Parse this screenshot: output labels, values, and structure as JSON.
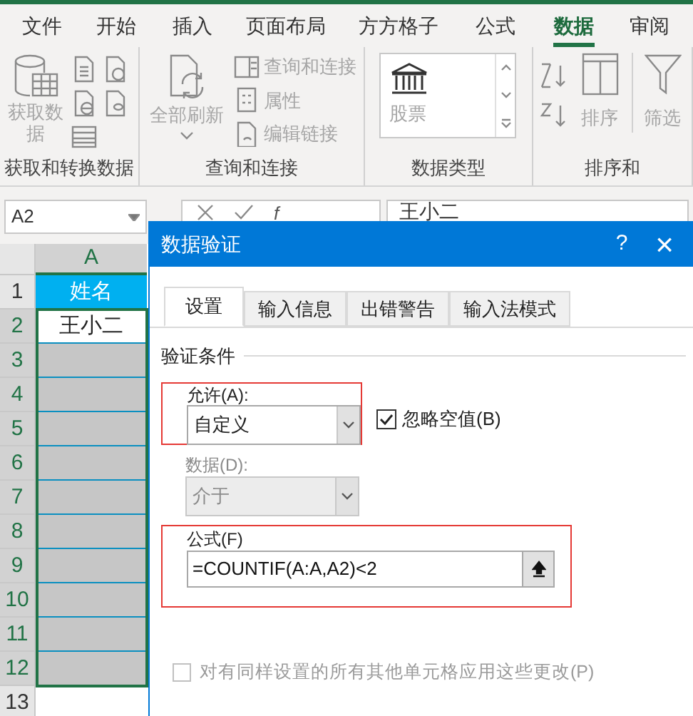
{
  "ribbon_tabs": [
    {
      "label": "文件",
      "selected": false
    },
    {
      "label": "开始",
      "selected": false
    },
    {
      "label": "插入",
      "selected": false
    },
    {
      "label": "页面布局",
      "selected": false
    },
    {
      "label": "方方格子",
      "selected": false
    },
    {
      "label": "公式",
      "selected": false
    },
    {
      "label": "数据",
      "selected": true
    },
    {
      "label": "审阅",
      "selected": false
    }
  ],
  "ribbon_groups": [
    {
      "label": "获取和转换数据",
      "buttons": [
        "获取数据"
      ]
    },
    {
      "label": "查询和连接",
      "buttons": [
        "全部刷新",
        "查询和连接",
        "属性",
        "编辑链接"
      ]
    },
    {
      "label": "数据类型",
      "buttons": [
        "股票"
      ]
    },
    {
      "label": "排序和",
      "buttons": [
        "排序",
        "筛选"
      ]
    }
  ],
  "name_box": "A2",
  "function_label": "f",
  "formula": "王小二",
  "sheet": {
    "column": "A",
    "rows": [
      {
        "number": "1",
        "value": "姓名",
        "kind": "header",
        "selected": false
      },
      {
        "number": "2",
        "value": "王小二",
        "kind": "data",
        "selected": true
      },
      {
        "number": "3",
        "kind": "data",
        "selected": true
      },
      {
        "number": "4",
        "kind": "data",
        "selected": true
      },
      {
        "number": "5",
        "kind": "data",
        "selected": true
      },
      {
        "number": "6",
        "kind": "data",
        "selected": true
      },
      {
        "number": "7",
        "kind": "data",
        "selected": true
      },
      {
        "number": "8",
        "kind": "data",
        "selected": true
      },
      {
        "number": "9",
        "kind": "data",
        "selected": true
      },
      {
        "number": "10",
        "kind": "data",
        "selected": true
      },
      {
        "number": "11",
        "kind": "data",
        "selected": true
      },
      {
        "number": "12",
        "kind": "data",
        "selected": true
      },
      {
        "number": "13",
        "kind": "data",
        "selected": false
      }
    ]
  },
  "dialog": {
    "title": "数据验证",
    "help": "?",
    "close": "×",
    "tabs": [
      {
        "label": "设置",
        "selected": true
      },
      {
        "label": "输入信息",
        "selected": false
      },
      {
        "label": "出错警告",
        "selected": false
      },
      {
        "label": "输入法模式",
        "selected": false
      }
    ],
    "section": "验证条件",
    "allow": {
      "label": "允许(A):",
      "value": "自定义",
      "disabled": false
    },
    "ignore_blank": {
      "label": "忽略空值(B)",
      "checked": true
    },
    "data": {
      "label": "数据(D):",
      "value": "介于",
      "disabled": true
    },
    "formula": {
      "label": "公式(F)",
      "value": "=COUNTIF(A:A,A2)<2"
    },
    "apply_all": {
      "label": "对有同样设置的所有其他单元格应用这些更改(P)",
      "checked": false
    }
  }
}
